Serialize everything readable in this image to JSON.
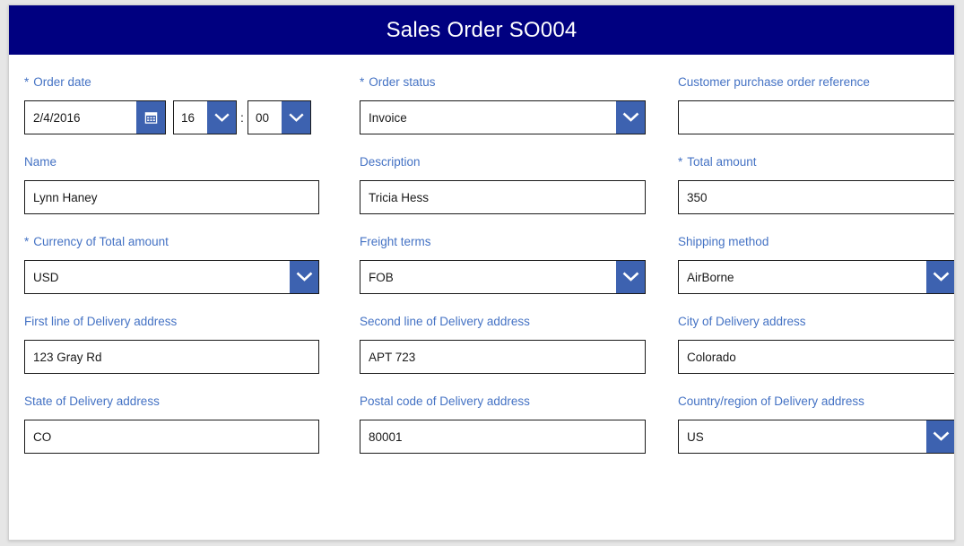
{
  "header": {
    "title": "Sales Order SO004"
  },
  "theme": {
    "header_bg": "#000080",
    "label_color": "#4472c4",
    "button_blue": "#3d62b0",
    "page_bg": "#e6e6e6",
    "card_bg": "#ffffff",
    "field_border": "#1a1a1a"
  },
  "form": {
    "rows": [
      {
        "fields": [
          {
            "name": "order-date",
            "label": "Order date",
            "required": true,
            "type": "datetime",
            "date_value": "2/4/2016",
            "hour_value": "16",
            "separator": ":",
            "minute_value": "00",
            "calendar_icon": "calendar-icon",
            "chevron_icon": "chevron-down-icon"
          },
          {
            "name": "order-status",
            "label": "Order status",
            "required": true,
            "type": "select",
            "value": "Invoice",
            "chevron_icon": "chevron-down-icon"
          },
          {
            "name": "customer-purchase-order-reference",
            "label": "Customer purchase order reference",
            "required": false,
            "type": "text",
            "value": "",
            "placeholder": ""
          }
        ]
      },
      {
        "fields": [
          {
            "name": "name",
            "label": "Name",
            "required": false,
            "type": "text",
            "value": "Lynn Haney",
            "placeholder": ""
          },
          {
            "name": "description",
            "label": "Description",
            "required": false,
            "type": "text",
            "value": "Tricia Hess",
            "placeholder": ""
          },
          {
            "name": "total-amount",
            "label": "Total amount",
            "required": true,
            "type": "text",
            "value": "350",
            "placeholder": ""
          }
        ]
      },
      {
        "fields": [
          {
            "name": "currency-of-total-amount",
            "label": "Currency of Total amount",
            "required": true,
            "type": "select",
            "value": "USD",
            "chevron_icon": "chevron-down-icon"
          },
          {
            "name": "freight-terms",
            "label": "Freight terms",
            "required": false,
            "type": "select",
            "value": "FOB",
            "chevron_icon": "chevron-down-icon"
          },
          {
            "name": "shipping-method",
            "label": "Shipping method",
            "required": false,
            "type": "select",
            "value": "AirBorne",
            "chevron_icon": "chevron-down-icon"
          }
        ]
      },
      {
        "fields": [
          {
            "name": "first-line-of-delivery-address",
            "label": "First line of Delivery address",
            "required": false,
            "type": "text",
            "value": "123 Gray Rd",
            "placeholder": ""
          },
          {
            "name": "second-line-of-delivery-address",
            "label": "Second line of Delivery address",
            "required": false,
            "type": "text",
            "value": "APT 723",
            "placeholder": ""
          },
          {
            "name": "city-of-delivery-address",
            "label": "City of Delivery address",
            "required": false,
            "type": "text",
            "value": "Colorado",
            "placeholder": ""
          }
        ]
      },
      {
        "fields": [
          {
            "name": "state-of-delivery-address",
            "label": "State of Delivery address",
            "required": false,
            "type": "text",
            "value": "CO",
            "placeholder": ""
          },
          {
            "name": "postal-code-of-delivery-address",
            "label": "Postal code of Delivery address",
            "required": false,
            "type": "text",
            "value": "80001",
            "placeholder": ""
          },
          {
            "name": "country-region-of-delivery-address",
            "label": "Country/region of Delivery address",
            "required": false,
            "type": "select",
            "value": "US",
            "chevron_icon": "chevron-down-icon"
          }
        ]
      }
    ]
  },
  "icons": {
    "required_star": "*"
  }
}
